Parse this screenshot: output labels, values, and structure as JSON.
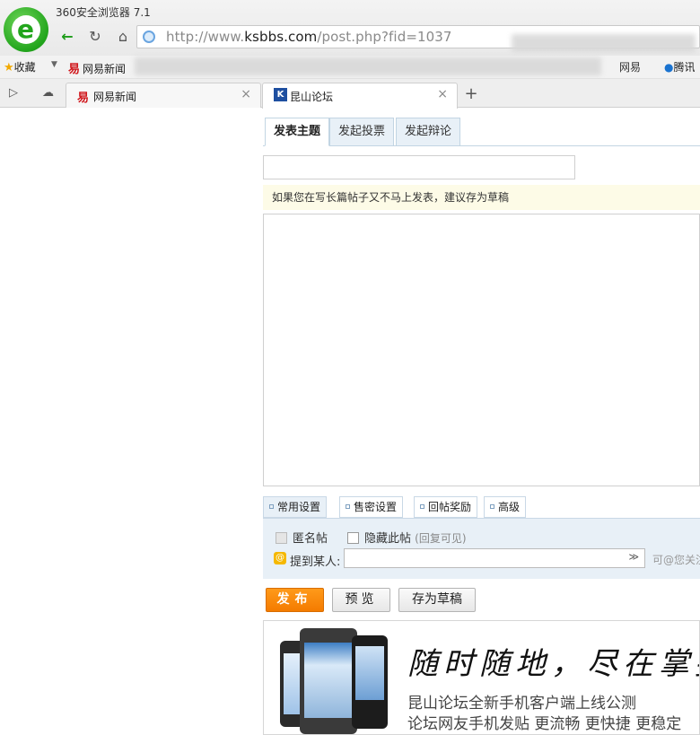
{
  "browser": {
    "title": "360安全浏览器 7.1",
    "url_prefix": "http://www.",
    "url_domain": "ksbbs.com",
    "url_path": "/post.php?fid=1037"
  },
  "bookmarks": {
    "favorites": "收藏",
    "netease": "网易新闻",
    "right_item": "网易",
    "tencent": "腾讯"
  },
  "tabs": [
    {
      "label": "网易新闻",
      "close": "×"
    },
    {
      "label": "昆山论坛",
      "close": "×"
    }
  ],
  "new_tab": "+",
  "post": {
    "tabs": [
      "发表主题",
      "发起投票",
      "发起辩论"
    ],
    "hint": "如果您在写长篇帖子又不马上发表，建议存为草稿",
    "option_tabs": [
      "常用设置",
      "售密设置",
      "回帖奖励",
      "高级"
    ],
    "anonymous": "匿名帖",
    "hide_post": "隐藏此帖",
    "hide_note": "(回复可见)",
    "mention_label": "提到某人:",
    "mention_tip": "可@您关注",
    "buttons": {
      "publish": "发布",
      "preview": "预览",
      "draft": "存为草稿"
    }
  },
  "banner": {
    "slogan": "随时随地，尽在掌握",
    "line1": "昆山论坛全新手机客户端上线公测",
    "line2": "论坛网友手机发贴 更流畅 更快捷 更稳定"
  },
  "colors": {
    "accent_green": "#22a51c",
    "publish_orange": "#f47b00",
    "panel_blue": "#e8f0f7"
  }
}
